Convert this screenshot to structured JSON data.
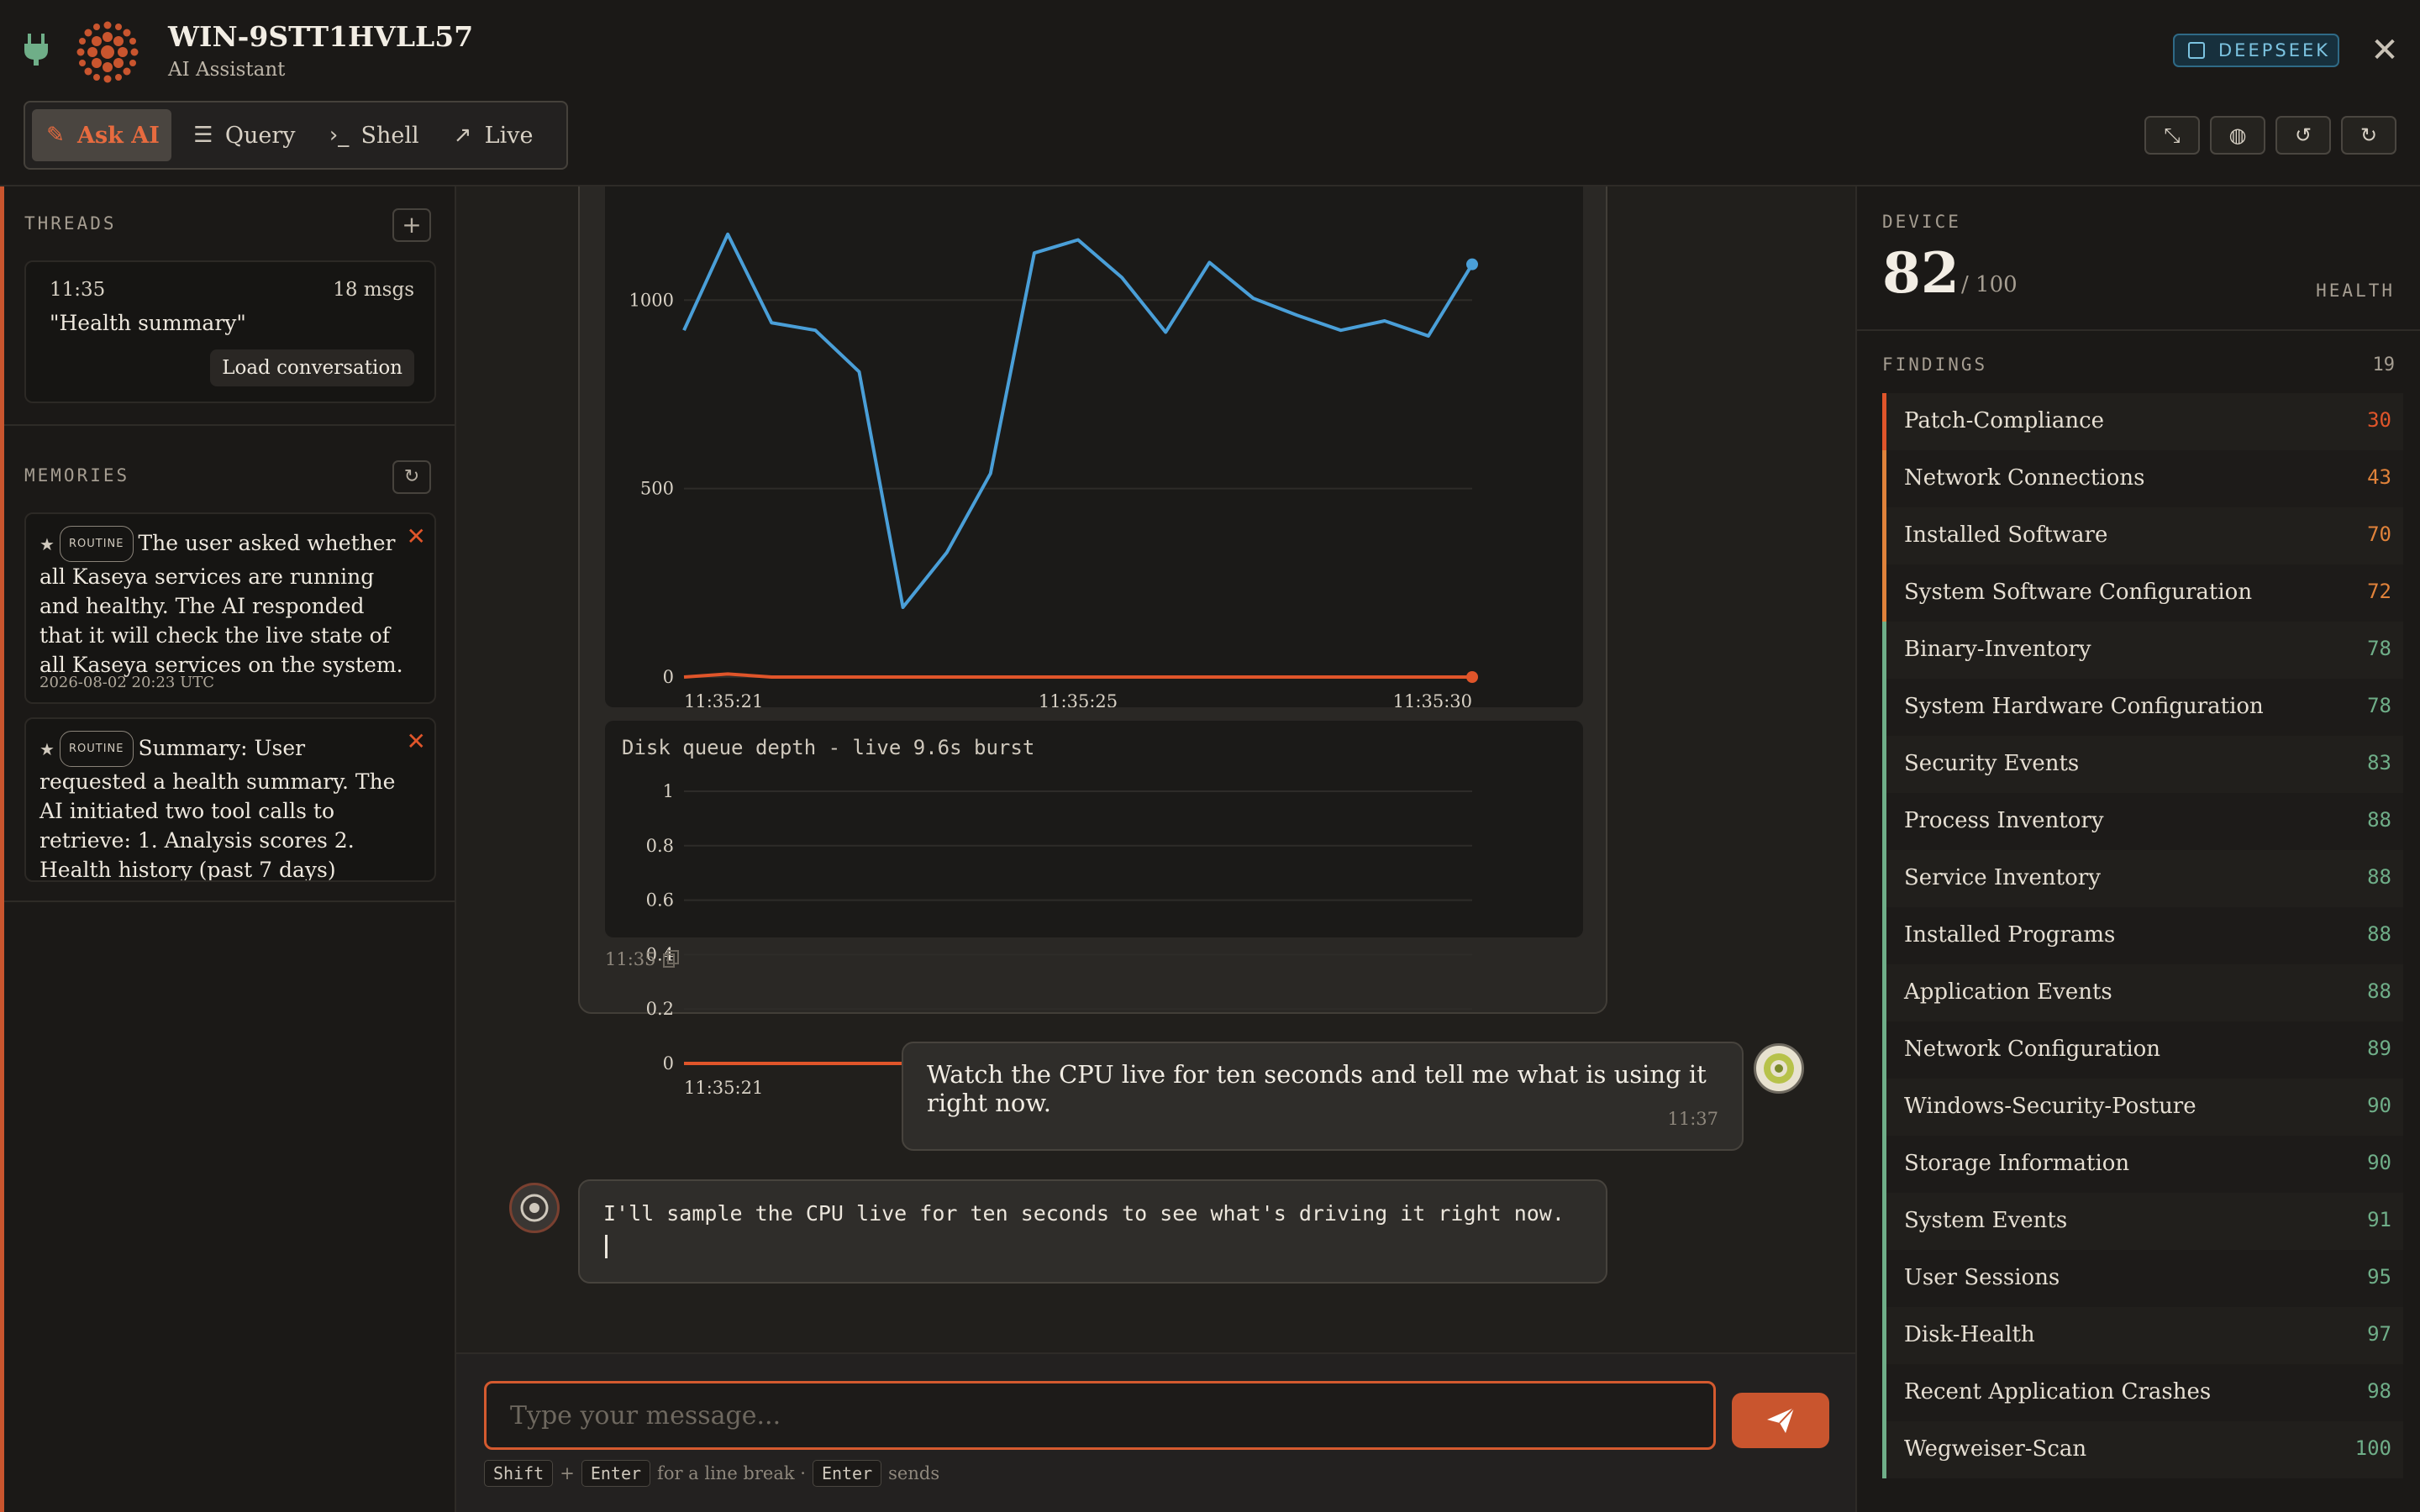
{
  "header": {
    "title": "WIN-9STT1HVLL57",
    "subtitle": "AI Assistant",
    "model_badge": "DEEPSEEK",
    "close": "✕"
  },
  "tabs": [
    {
      "label": "Ask AI",
      "icon": "magic-wand-icon",
      "active": true
    },
    {
      "label": "Query",
      "icon": "database-icon",
      "active": false
    },
    {
      "label": "Shell",
      "icon": "terminal-icon",
      "active": false
    },
    {
      "label": "Live",
      "icon": "chart-line-icon",
      "active": false
    }
  ],
  "toolbar": [
    "compress-icon",
    "brain-icon",
    "history-icon",
    "refresh-icon"
  ],
  "sidebar": {
    "threads_label": "THREADS",
    "thread": {
      "time": "11:35",
      "count": "18 msgs",
      "title": "\"Health summary\"",
      "load_label": "Load conversation"
    },
    "memories_label": "MEMORIES",
    "memories": [
      {
        "badge": "ROUTINE",
        "text": "The user asked whether all Kaseya services are running and healthy. The AI responded that it will check the live state of all Kaseya services on the system.",
        "date": "2026-08-02 20:23 UTC"
      },
      {
        "badge": "ROUTINE",
        "text": "Summary: User requested a health summary. The AI initiated two tool calls to retrieve: 1. Analysis scores 2. Health history (past 7 days)",
        "date": ""
      }
    ]
  },
  "chat": {
    "card_time": "11:35",
    "user_message": {
      "text": "Watch the CPU live for ten seconds and tell me what is using it right now.",
      "time": "11:37"
    },
    "ai_message": {
      "text": "I'll sample the CPU live for ten seconds to see what's driving it right now."
    }
  },
  "input": {
    "placeholder": "Type your message...",
    "hint_shift": "Shift",
    "hint_plus": "+",
    "hint_enter": "Enter",
    "hint_mid": "for a line break ·",
    "hint_enter2": "Enter",
    "hint_end": "sends"
  },
  "device": {
    "label": "DEVICE",
    "score": "82",
    "max": "/ 100",
    "health_label": "HEALTH",
    "findings_label": "FINDINGS",
    "findings_count": "19",
    "findings": [
      {
        "name": "Patch-Compliance",
        "score": "30",
        "color": "#e0552a"
      },
      {
        "name": "Network Connections",
        "score": "43",
        "color": "#e0823a"
      },
      {
        "name": "Installed Software",
        "score": "70",
        "color": "#e0823a"
      },
      {
        "name": "System Software Configuration",
        "score": "72",
        "color": "#e0823a"
      },
      {
        "name": "Binary-Inventory",
        "score": "78",
        "color": "#6fae88"
      },
      {
        "name": "System Hardware Configuration",
        "score": "78",
        "color": "#6fae88"
      },
      {
        "name": "Security Events",
        "score": "83",
        "color": "#6fae88"
      },
      {
        "name": "Process Inventory",
        "score": "88",
        "color": "#6fae88"
      },
      {
        "name": "Service Inventory",
        "score": "88",
        "color": "#6fae88"
      },
      {
        "name": "Installed Programs",
        "score": "88",
        "color": "#6fae88"
      },
      {
        "name": "Application Events",
        "score": "88",
        "color": "#6fae88"
      },
      {
        "name": "Network Configuration",
        "score": "89",
        "color": "#6fae88"
      },
      {
        "name": "Windows-Security-Posture",
        "score": "90",
        "color": "#6fae88"
      },
      {
        "name": "Storage Information",
        "score": "90",
        "color": "#6fae88"
      },
      {
        "name": "System Events",
        "score": "91",
        "color": "#6fae88"
      },
      {
        "name": "User Sessions",
        "score": "95",
        "color": "#6fae88"
      },
      {
        "name": "Disk-Health",
        "score": "97",
        "color": "#6fae88"
      },
      {
        "name": "Recent Application Crashes",
        "score": "98",
        "color": "#6fae88"
      },
      {
        "name": "Wegweiser-Scan",
        "score": "100",
        "color": "#6fae88"
      }
    ]
  },
  "chart_data": [
    {
      "type": "line",
      "title": "",
      "x": [
        "11:35:21",
        "11:35:22",
        "11:35:23",
        "11:35:23.5",
        "11:35:24",
        "11:35:24.5",
        "11:35:25",
        "11:35:25.5",
        "11:35:26",
        "11:35:26.5",
        "11:35:27",
        "11:35:27.5",
        "11:35:28",
        "11:35:28.5",
        "11:35:29",
        "11:35:29.5",
        "11:35:30"
      ],
      "xticks": [
        "11:35:21",
        "11:35:25",
        "11:35:30"
      ],
      "yticks": [
        "0",
        "500",
        "1000"
      ],
      "ylim": [
        0,
        1150
      ],
      "series": [
        {
          "color": "#4a9fd8",
          "values": [
            920,
            1175,
            940,
            920,
            810,
            185,
            330,
            540,
            1125,
            1160,
            1060,
            915,
            1100,
            1005,
            960,
            920,
            945,
            905,
            1095
          ]
        },
        {
          "color": "#e0552a",
          "values": [
            0,
            8,
            0,
            0,
            0,
            0,
            0,
            0,
            0,
            0,
            0,
            0,
            0,
            0,
            0,
            0,
            0,
            0,
            0
          ]
        }
      ]
    },
    {
      "type": "line",
      "title": "Disk queue depth - live 9.6s burst",
      "xticks": [
        "11:35:21",
        "11:35:25",
        "11:35:30"
      ],
      "yticks": [
        "0",
        "0.2",
        "0.4",
        "0.6",
        "0.8",
        "1"
      ],
      "ylim": [
        0,
        1
      ],
      "end_label": "0",
      "series": [
        {
          "color": "#e0552a",
          "values": [
            0,
            0,
            0,
            0,
            0,
            0,
            0,
            0,
            0,
            0,
            0,
            0,
            0,
            0,
            0,
            0,
            0,
            0,
            0
          ]
        }
      ]
    }
  ]
}
